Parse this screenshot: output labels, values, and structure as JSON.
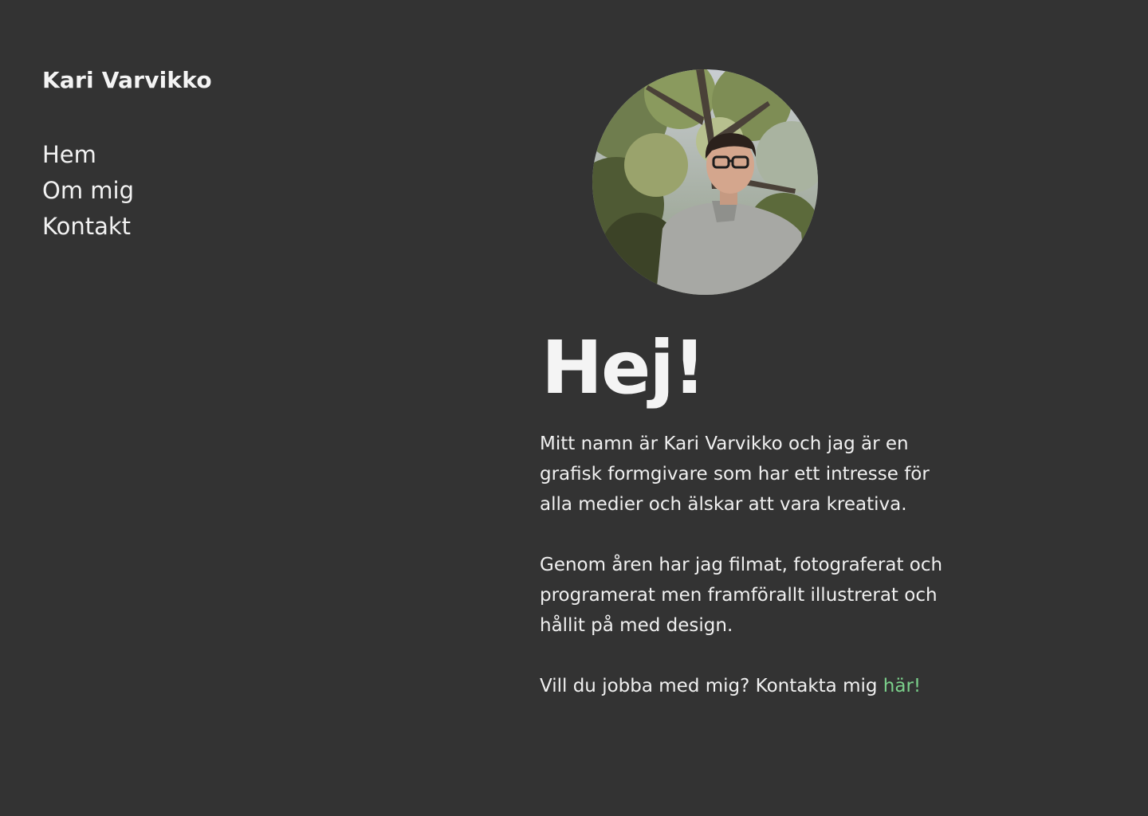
{
  "site": {
    "name": "Kari Varvikko"
  },
  "nav": {
    "items": [
      {
        "label": "Hem"
      },
      {
        "label": "Om mig"
      },
      {
        "label": "Kontakt"
      }
    ]
  },
  "hero": {
    "title": "Hej!",
    "paragraphs": [
      " Mitt namn är Kari Varvikko och jag är en grafisk formgivare som har ett intresse för alla medier och älskar att vara kreativa.",
      "Genom åren har jag filmat, fotograferat och programerat men framförallt illustrerat och hållit på med design."
    ],
    "cta_text": "Vill du jobba med mig? Kontakta mig ",
    "cta_link": "här!"
  },
  "colors": {
    "background": "#333333",
    "text": "#f2f2f2",
    "link": "#7bd08b"
  }
}
